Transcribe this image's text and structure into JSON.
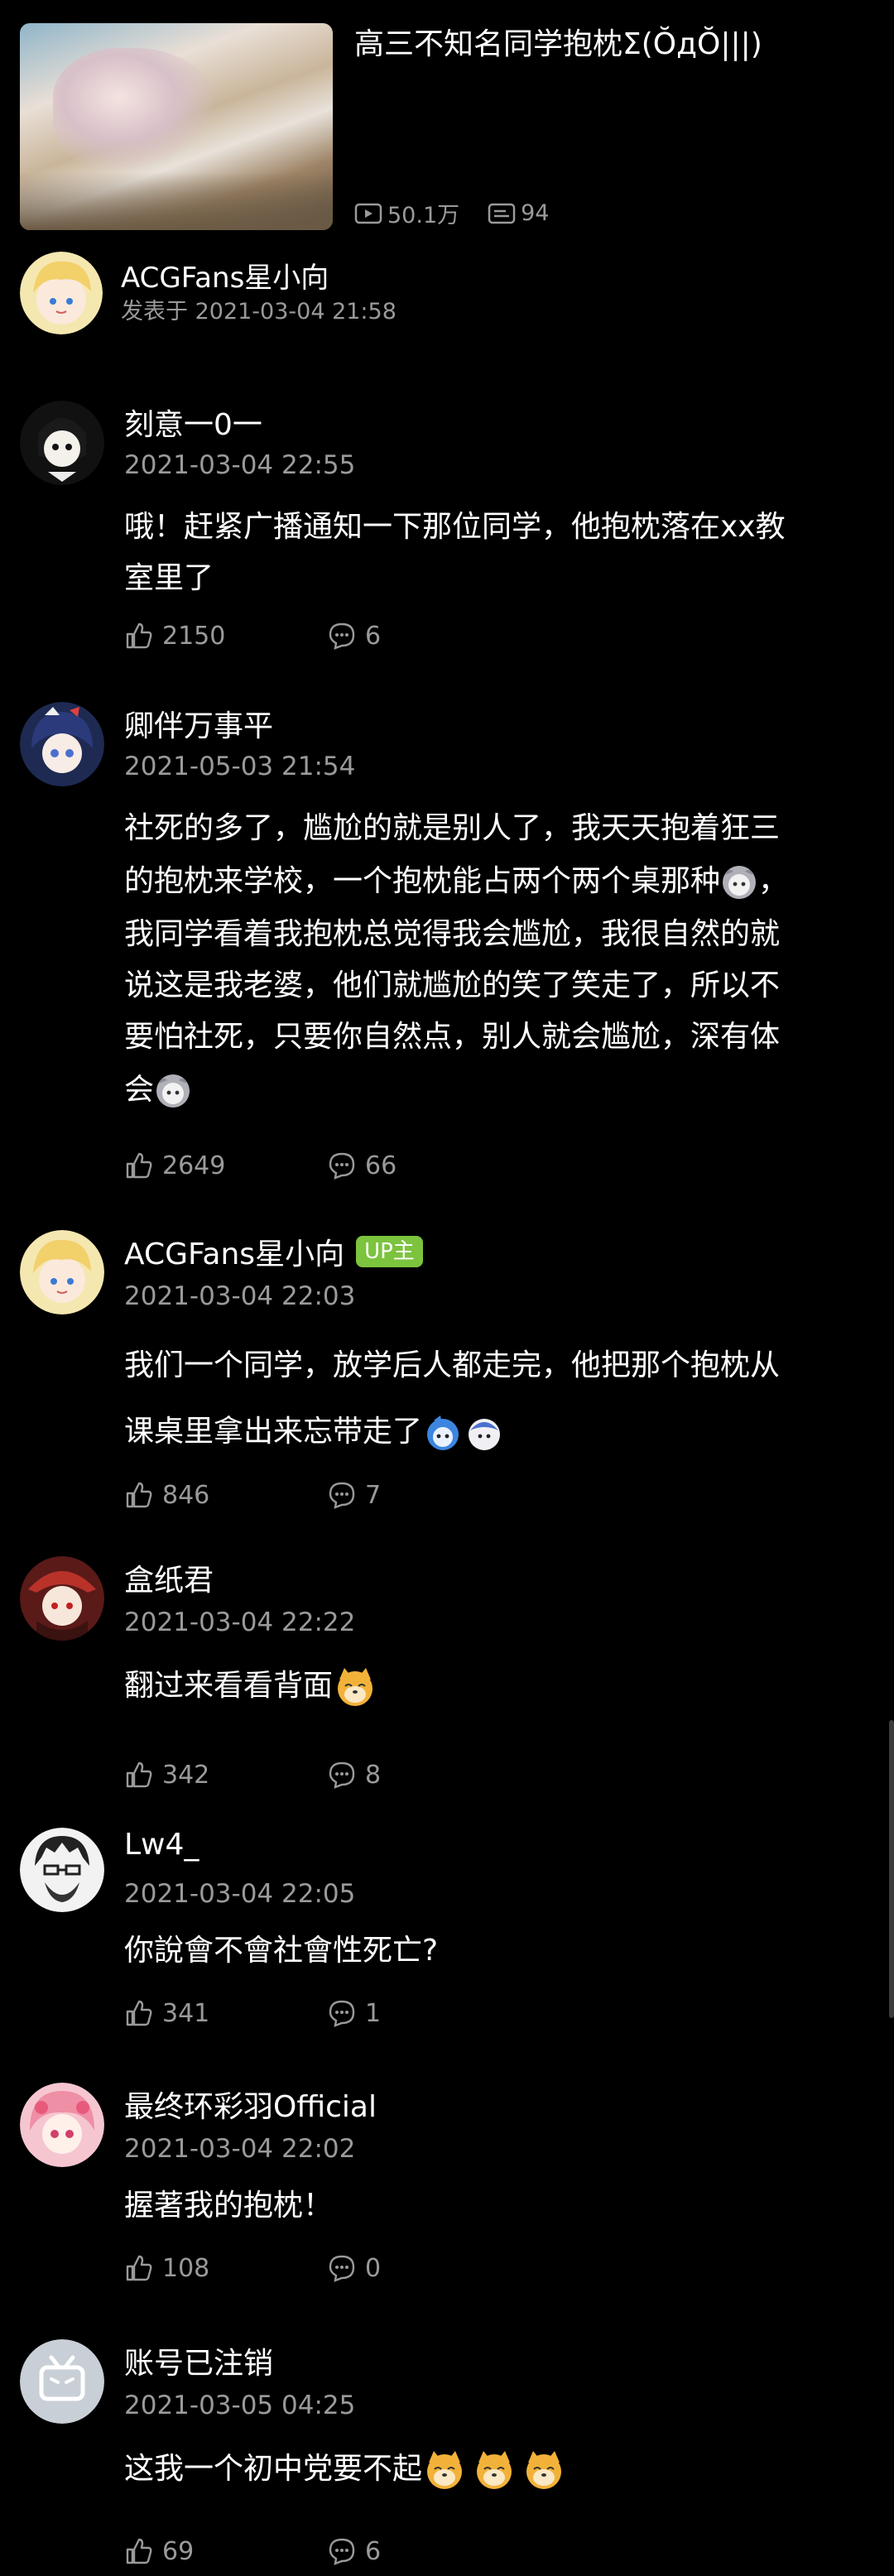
{
  "video": {
    "title": "高三不知名同学抱枕Σ(ŎдŎ|||)",
    "views": "50.1万",
    "comments": "94"
  },
  "post": {
    "author": "ACGFans星小向",
    "meta": "发表于 2021-03-04 21:58"
  },
  "comments": [
    {
      "name": "刻意一0一",
      "time": "2021-03-04 22:55",
      "lines": [
        "哦！赶紧广播通知一下那位同学，他抱枕落在xx教",
        "室里了"
      ],
      "likes": "2150",
      "replies": "6",
      "avatar_color": "#e8e8e8"
    },
    {
      "name": "卿伴万事平",
      "time": "2021-05-03 21:54",
      "lines": [
        "社死的多了，尴尬的就是别人了，我天天抱着狂三",
        "的抱枕来学校，一个抱枕能占两个两个桌那种",
        "我同学看着我抱枕总觉得我会尴尬，我很自然的就",
        "说这是我老婆，他们就尴尬的笑了笑走了，所以不",
        "要怕社死，只要你自然点，别人就会尴尬，深有体",
        "会"
      ],
      "line2_suffix": "，",
      "likes": "2649",
      "replies": "66",
      "avatar_color": "#3a4a7a"
    },
    {
      "name": "ACGFans星小向",
      "badge": "UP主",
      "time": "2021-03-04 22:03",
      "lines": [
        "我们一个同学，放学后人都走完，他把那个抱枕从",
        "课桌里拿出来忘带走了"
      ],
      "likes": "846",
      "replies": "7",
      "avatar_color": "#f2e6a8"
    },
    {
      "name": "盒纸君",
      "time": "2021-03-04 22:22",
      "lines": [
        "翻过来看看背面"
      ],
      "likes": "342",
      "replies": "8",
      "avatar_color": "#8a2a24"
    },
    {
      "name": "Lw4_",
      "time": "2021-03-04 22:05",
      "lines": [
        "你說會不會社會性死亡?"
      ],
      "likes": "341",
      "replies": "1",
      "avatar_color": "#cfcfcf"
    },
    {
      "name": "最终环彩羽Official",
      "time": "2021-03-04 22:02",
      "lines": [
        "握著我的抱枕！"
      ],
      "likes": "108",
      "replies": "0",
      "avatar_color": "#f3b8c4"
    },
    {
      "name": "账号已注销",
      "time": "2021-03-05 04:25",
      "lines": [
        "这我一个初中党要不起"
      ],
      "likes": "69",
      "replies": "6",
      "avatar_color": "#c9cfd6"
    }
  ],
  "colors": {
    "background": "#000000",
    "text": "#ffffff",
    "secondary": "#9a9a9a",
    "up_badge": "#7cc33e"
  }
}
